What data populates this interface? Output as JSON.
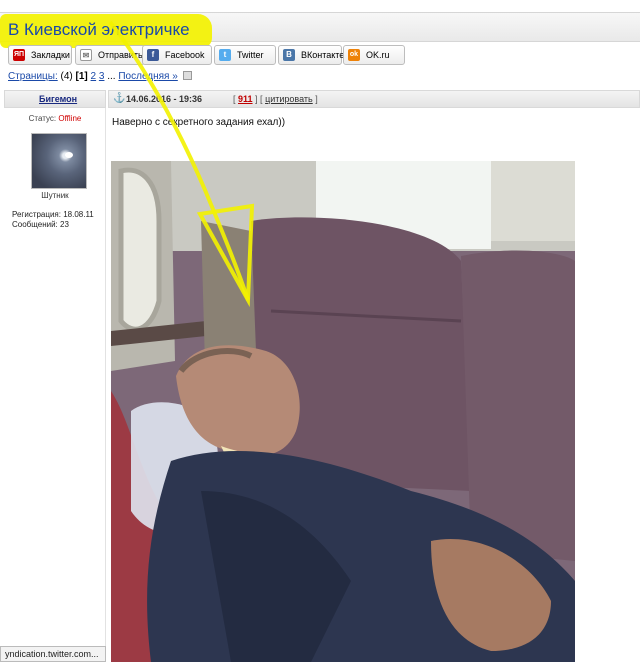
{
  "header": {
    "title": "В Киевской электричке"
  },
  "share": {
    "buttons": [
      {
        "label": "Закладки",
        "icon": "bookmark-icon",
        "icon_text": "ЯП",
        "color": "#cc0000"
      },
      {
        "label": "Отправить",
        "icon": "mail-icon",
        "icon_text": "✉",
        "color": "#888888"
      },
      {
        "label": "Facebook",
        "icon": "facebook-icon",
        "icon_text": "f",
        "color": "#3b5998"
      },
      {
        "label": "Twitter",
        "icon": "twitter-icon",
        "icon_text": "t",
        "color": "#55acee"
      },
      {
        "label": "ВКонтакте",
        "icon": "vk-icon",
        "icon_text": "B",
        "color": "#4a76a8"
      },
      {
        "label": "OK.ru",
        "icon": "ok-icon",
        "icon_text": "ok",
        "color": "#ee8208"
      }
    ]
  },
  "pagination": {
    "label": "Страницы:",
    "count": "(4)",
    "current": "[1]",
    "pages": [
      "2",
      "3"
    ],
    "ellipsis": "...",
    "last": "Последняя »"
  },
  "post": {
    "author": "Бигемон",
    "date": "14.06.2016 - 19:36",
    "post_number": "911",
    "quote_label": "цитировать",
    "text": "Наверно с секретного задания ехал))"
  },
  "user": {
    "status_label": "Статус:",
    "status_value": "Offline",
    "title": "Шутник",
    "registration": "Регистрация: 18.08.11",
    "messages": "Сообщений: 23"
  },
  "statusbar": {
    "url": "yndication.twitter.com..."
  },
  "colors": {
    "link": "#1a49a8",
    "highlight": "#f3f200",
    "offline": "#d00000",
    "post_number": "#c00000"
  }
}
